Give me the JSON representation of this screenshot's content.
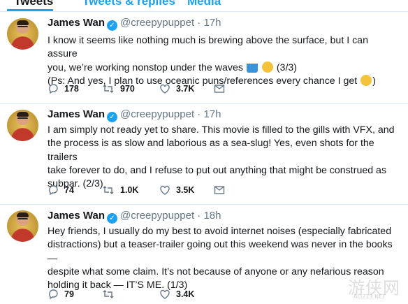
{
  "tabs": [
    {
      "label": "Tweets"
    },
    {
      "label": "Tweets & replies"
    },
    {
      "label": "Media"
    }
  ],
  "tweets": [
    {
      "name": "James Wan",
      "handle": "@creepypuppet",
      "dot": "·",
      "time": "17h",
      "lines": [
        "I know it seems like nothing much is brewing above the surface, but I can assure",
        "you, we’re working nonstop under the waves",
        "(3/3)",
        "(Ps: And yes, I plan to use oceanic puns/references every chance I get"
      ],
      "emojis": [
        "water-wave-emoji",
        "winking-face-emoji",
        "face-with-tears-of-joy-emoji"
      ],
      "replies": "178",
      "retweets": "970",
      "likes": "3.7K"
    },
    {
      "name": "James Wan",
      "handle": "@creepypuppet",
      "dot": "·",
      "time": "17h",
      "lines": [
        "I am simply not ready yet to share. This movie is filled to the gills with VFX, and",
        "the process is as slow and laborious as a sea-slug! Yes, even shots for the trailers",
        "take forever to do, and I refuse to put out anything that might be construed as",
        "subpar. (2/3)"
      ],
      "replies": "74",
      "retweets": "1.0K",
      "likes": "3.5K"
    },
    {
      "name": "James Wan",
      "handle": "@creepypuppet",
      "dot": "·",
      "time": "18h",
      "lines": [
        "Hey friends, I usually do my best to avoid internet noises (especially fabricated",
        "distractions) but a teaser-trailer going out this weekend was never in the books —",
        "despite what some claim. It’s not because of anyone or any nefarious reason",
        "holding it back — IT’S ME. (1/3)"
      ],
      "replies": "79",
      "retweets": "",
      "likes": "3.4K"
    }
  ],
  "watermark": {
    "text": "游侠网",
    "url": "ALI213.NET"
  },
  "colors": {
    "accent": "#1da1f2",
    "text": "#14171a",
    "muted": "#657786",
    "divider": "#e1e8ed"
  }
}
